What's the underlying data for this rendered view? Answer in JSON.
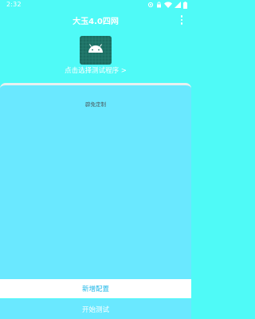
{
  "status_bar": {
    "time": "2:32",
    "icons": [
      "settings-icon",
      "lock-icon",
      "wifi-icon",
      "signal-icon",
      "battery-icon"
    ]
  },
  "app_bar": {
    "title": "大玉4.0四网",
    "menu_icon": "more-vert-icon"
  },
  "program_picker": {
    "icon": "android-icon",
    "label": "点击选择测试程序 >"
  },
  "config_card": {
    "label": "辟免定制"
  },
  "actions": {
    "add_config": "新增配置",
    "start_test": "开始测试"
  },
  "colors": {
    "background": "#4ffaf7",
    "card": "#6ae8ff",
    "icon_bg": "#1b6d61",
    "android_green": "#ffffff",
    "accent_text": "#25b9e8"
  }
}
